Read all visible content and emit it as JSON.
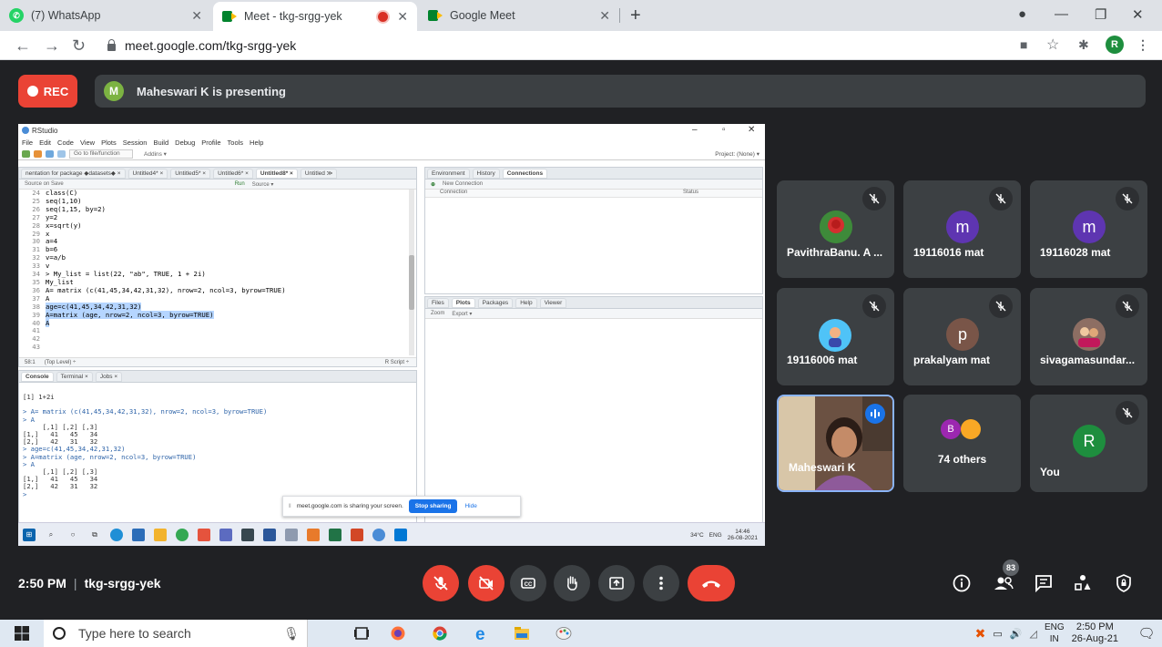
{
  "browser": {
    "tabs": [
      {
        "title": "(7) WhatsApp",
        "active": false
      },
      {
        "title": "Meet - tkg-srgg-yek",
        "active": true
      },
      {
        "title": "Google Meet",
        "active": false
      }
    ],
    "url": "meet.google.com/tkg-srgg-yek",
    "profile_initial": "R"
  },
  "meet": {
    "rec_label": "REC",
    "presenter_initial": "M",
    "presenting_text": "Maheswari K is presenting",
    "meeting_time": "2:50 PM",
    "meeting_code": "tkg-srgg-yek",
    "people_count": "83",
    "participants": [
      {
        "name": "PavithraBanu. A ...",
        "avatar": "rose-photo",
        "muted": true
      },
      {
        "name": "19116016 mat",
        "initial": "m",
        "color": "#5e35b1",
        "muted": true
      },
      {
        "name": "19116028 mat",
        "initial": "m",
        "color": "#5e35b1",
        "muted": true
      },
      {
        "name": "19116006 mat",
        "avatar": "cartoon-photo",
        "muted": true
      },
      {
        "name": "prakalyam mat",
        "initial": "p",
        "color": "#795548",
        "muted": true
      },
      {
        "name": "sivagamasundar...",
        "avatar": "group-photo",
        "muted": true
      },
      {
        "name": "Maheswari K",
        "speaking": true
      },
      {
        "name": "74 others",
        "initial": "B"
      },
      {
        "name": "You",
        "initial": "R",
        "color": "#1e8e3e",
        "muted": true
      }
    ]
  },
  "rstudio": {
    "window_title": "RStudio",
    "menu": [
      "File",
      "Edit",
      "Code",
      "View",
      "Plots",
      "Session",
      "Build",
      "Debug",
      "Profile",
      "Tools",
      "Help"
    ],
    "goto_placeholder": "Go to file/function",
    "addins": "Addins ▾",
    "project": "Project: (None) ▾",
    "editor_tabs": [
      "nentation for package ◆datasets◆ ×",
      "Untitled4* ×",
      "Untitled5* ×",
      "Untitled6* ×",
      "Untitled8* ×",
      "Untitled ≫"
    ],
    "editor_sub": [
      "Source on Save",
      "Run",
      "Source ▾"
    ],
    "code_lines": [
      {
        "n": "24",
        "t": "class(C)"
      },
      {
        "n": "25",
        "t": "seq(1,10)"
      },
      {
        "n": "26",
        "t": "seq(1,15, by=2)"
      },
      {
        "n": "27",
        "t": "y=2"
      },
      {
        "n": "28",
        "t": "x=sqrt(y)"
      },
      {
        "n": "29",
        "t": "x"
      },
      {
        "n": "30",
        "t": "a=4"
      },
      {
        "n": "31",
        "t": "b=6"
      },
      {
        "n": "32",
        "t": "v=a/b"
      },
      {
        "n": "33",
        "t": "v"
      },
      {
        "n": "34",
        "t": "> My_list = list(22, \"ab\", TRUE, 1 + 2i)"
      },
      {
        "n": "35",
        "t": "My_list"
      },
      {
        "n": "36",
        "t": "A= matrix (c(41,45,34,42,31,32), nrow=2, ncol=3, byrow=TRUE)"
      },
      {
        "n": "37",
        "t": "A"
      },
      {
        "n": "38",
        "t": "age=c(41,45,34,42,31,32)",
        "sel": true
      },
      {
        "n": "39",
        "t": "A=matrix (age, nrow=2, ncol=3, byrow=TRUE)",
        "sel": true
      },
      {
        "n": "40",
        "t": "A",
        "sel": true
      },
      {
        "n": "41",
        "t": ""
      },
      {
        "n": "42",
        "t": ""
      },
      {
        "n": "43",
        "t": ""
      }
    ],
    "editor_status": [
      "58:1",
      "(Top Level) ÷",
      "R Script ÷"
    ],
    "console_tabs": [
      "Console",
      "Terminal ×",
      "Jobs ×"
    ],
    "console_lines": [
      "[1] 1+2i",
      "",
      "> A= matrix (c(41,45,34,42,31,32), nrow=2, ncol=3, byrow=TRUE)",
      "> A",
      "     [,1] [,2] [,3]",
      "[1,]   41   45   34",
      "[2,]   42   31   32",
      "> age=c(41,45,34,42,31,32)",
      "> A=matrix (age, nrow=2, ncol=3, byrow=TRUE)",
      "> A",
      "     [,1] [,2] [,3]",
      "[1,]   41   45   34",
      "[2,]   42   31   32",
      ">"
    ],
    "env_tabs": [
      "Environment",
      "History",
      "Connections"
    ],
    "new_connection": "New Connection",
    "conn_headers": [
      "Connection",
      "Status"
    ],
    "files_tabs": [
      "Files",
      "Plots",
      "Packages",
      "Help",
      "Viewer"
    ],
    "files_sub": [
      "Zoom",
      "Export ▾"
    ],
    "sharing_text": "meet.google.com is sharing your screen.",
    "stop_sharing": "Stop sharing",
    "hide": "Hide",
    "tray_weather": "34°C",
    "tray_lang": "ENG",
    "tray_time": "14:46",
    "tray_date": "26-08-2021"
  },
  "windows": {
    "search_placeholder": "Type here to search",
    "lang": "ENG",
    "lang2": "IN",
    "time": "2:50 PM",
    "date": "26-Aug-21"
  }
}
